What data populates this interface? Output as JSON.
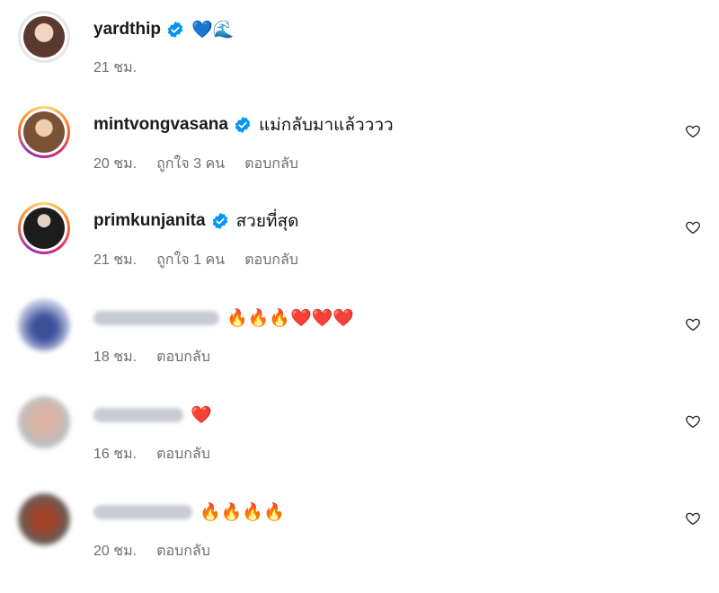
{
  "comments": [
    {
      "username": "yardthip",
      "text": "💙🌊",
      "time": "21 ชม.",
      "likes": "",
      "reply": "",
      "avatar_ring": "none",
      "avatar_color": "#c99a82"
    },
    {
      "username": "mintvongvasana",
      "text": "แม่กลับมาแล้วววว",
      "time": "20 ชม.",
      "likes": "ถูกใจ 3 คน",
      "reply": "ตอบกลับ",
      "avatar_ring": "story",
      "avatar_color": "#d8a27a"
    },
    {
      "username": "primkunjanita",
      "text": "สวยที่สุด",
      "time": "21 ชม.",
      "likes": "ถูกใจ 1 คน",
      "reply": "ตอบกลับ",
      "avatar_ring": "story",
      "avatar_color": "#333333"
    },
    {
      "username": "",
      "text": "🔥🔥🔥❤️❤️❤️",
      "time": "18 ชม.",
      "likes": "",
      "reply": "ตอบกลับ",
      "avatar_ring": "none",
      "avatar_color": "#5a6fa8"
    },
    {
      "username": "",
      "text": "❤️",
      "time": "16 ชม.",
      "likes": "",
      "reply": "ตอบกลับ",
      "avatar_ring": "none",
      "avatar_color": "#cfa393"
    },
    {
      "username": "",
      "text": "🔥🔥🔥🔥",
      "time": "20 ชม.",
      "likes": "",
      "reply": "ตอบกลับ",
      "avatar_ring": "none",
      "avatar_color": "#b05a3a"
    }
  ],
  "colors": {
    "verified": "#0095f6",
    "secondary_text": "#6e6e6e"
  }
}
